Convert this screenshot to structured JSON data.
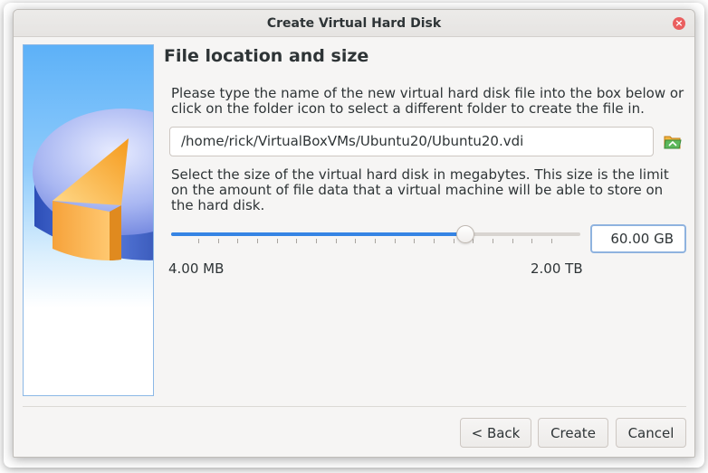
{
  "window": {
    "title": "Create Virtual Hard Disk",
    "close_glyph": "×"
  },
  "page": {
    "heading": "File location and size",
    "location_description": "Please type the name of the new virtual hard disk file into the box below or click on the folder icon to select a different folder to create the file in.",
    "file_path": "/home/rick/VirtualBoxVMs/Ubuntu20/Ubuntu20.vdi",
    "folder_icon": "folder-open-icon",
    "size_description": "Select the size of the virtual hard disk in megabytes. This size is the limit on the amount of file data that a virtual machine will be able to store on the hard disk.",
    "size_value": "60.00 GB",
    "slider_level": 0.72,
    "slider_tick_count": 19,
    "slider_min_label": "4.00 MB",
    "slider_max_label": "2.00 TB"
  },
  "buttons": {
    "back": "< Back",
    "create": "Create",
    "cancel": "Cancel"
  },
  "colors": {
    "accent": "#3584e4",
    "close": "#ea5f5f",
    "window_bg": "#f6f5f4"
  }
}
